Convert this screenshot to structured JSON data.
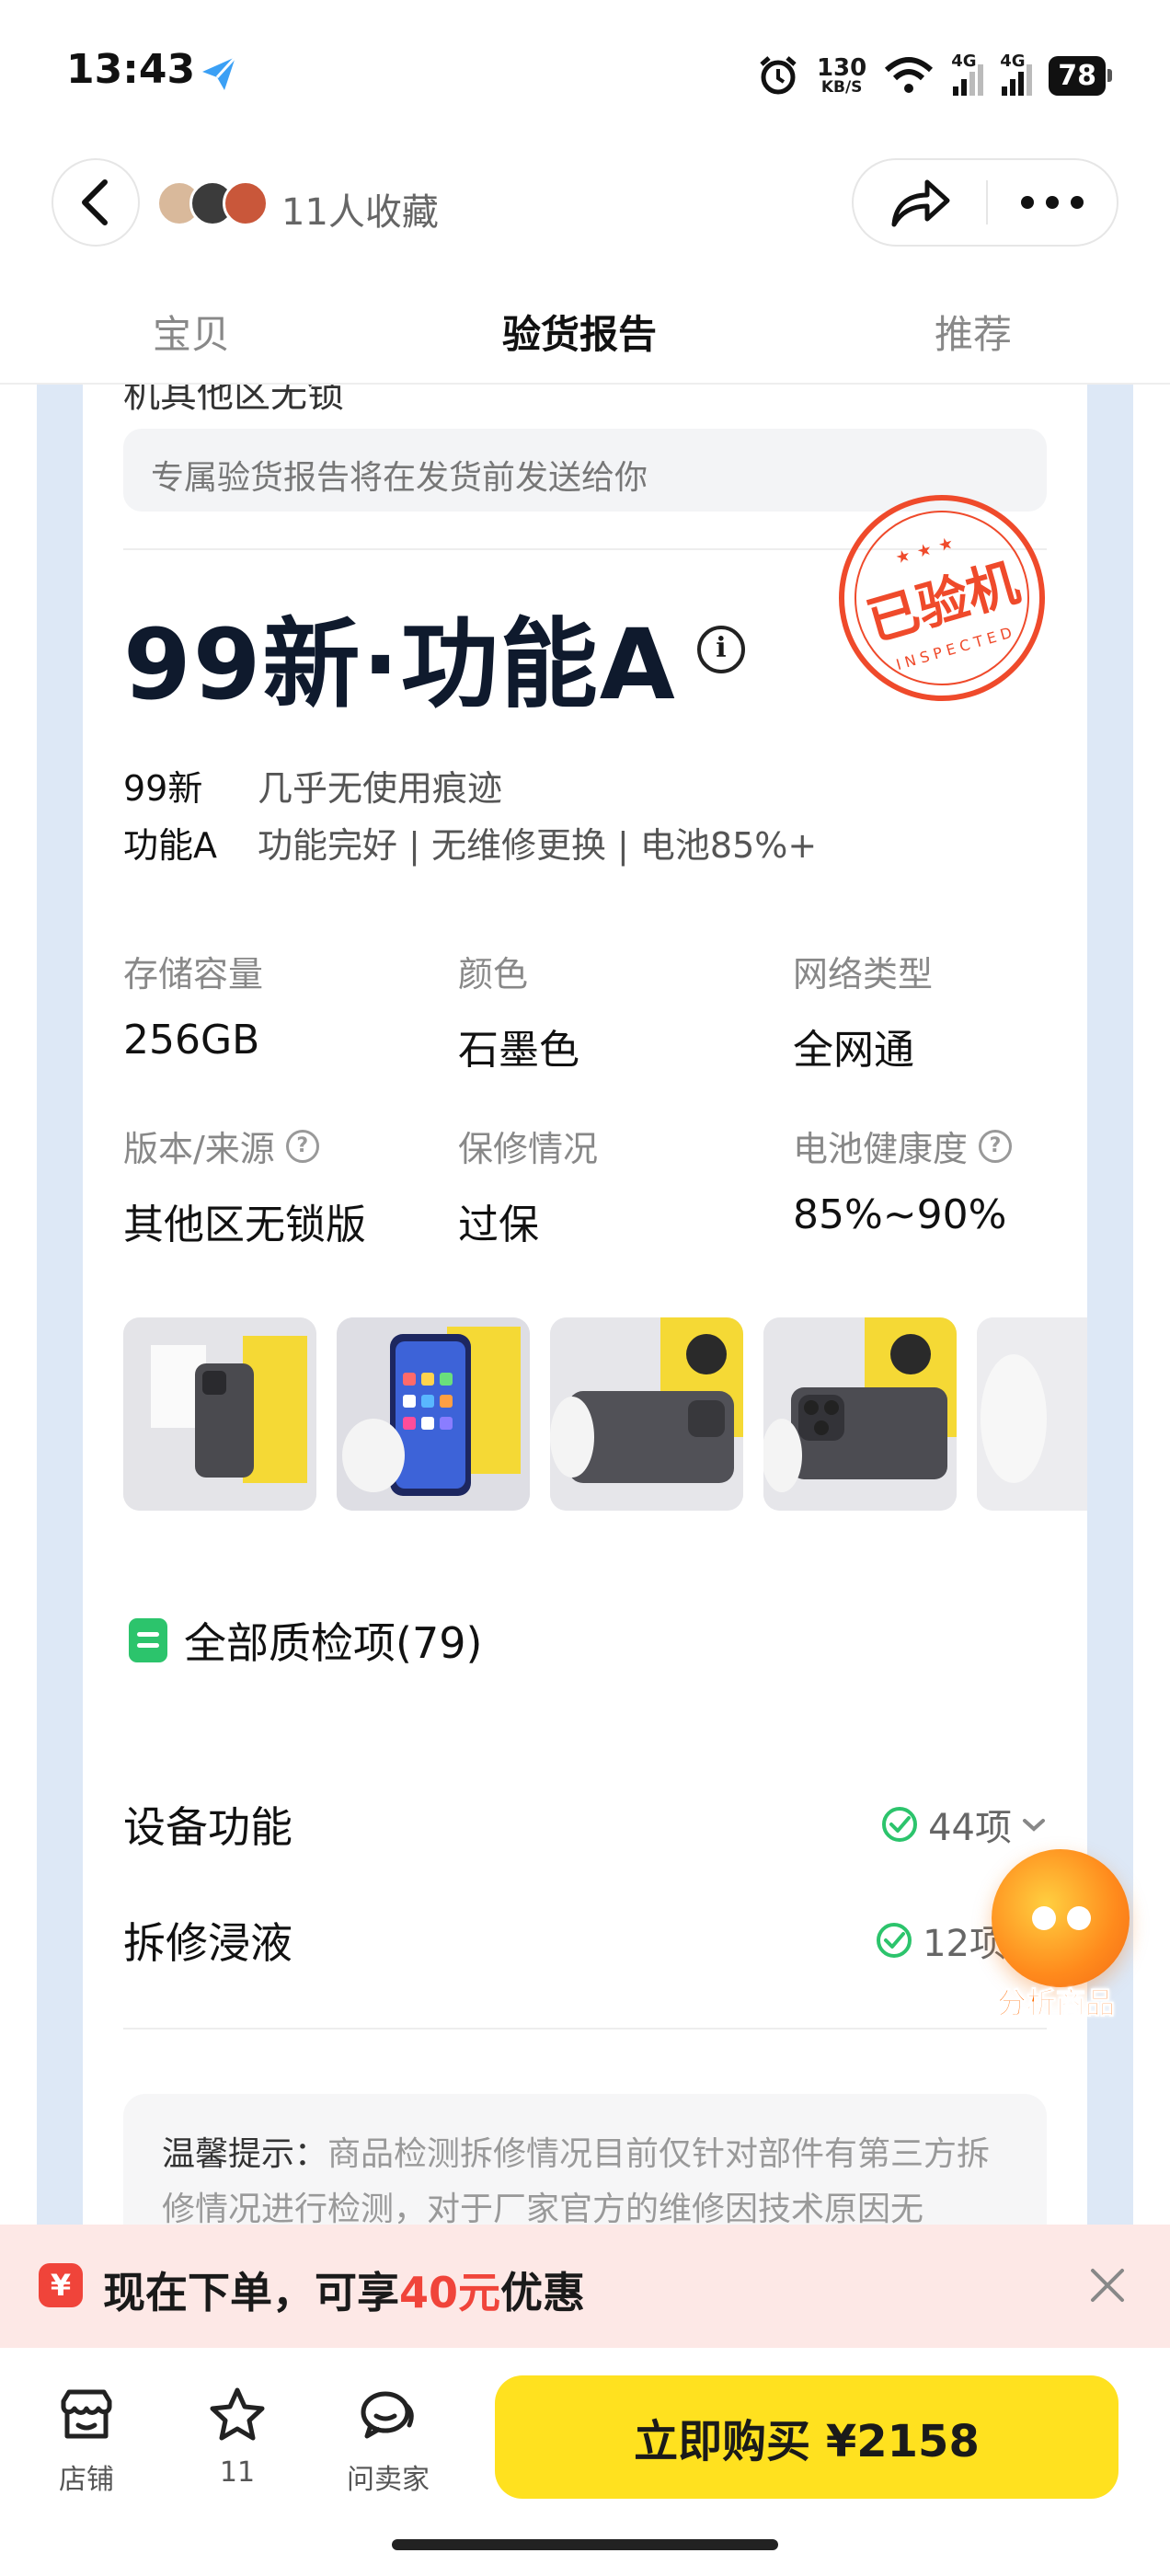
{
  "status_bar": {
    "time": "13:43",
    "speed_value": "130",
    "speed_unit": "KB/S",
    "net1": "4G",
    "net2": "4G",
    "battery": "78"
  },
  "header": {
    "fav_text": "11人收藏"
  },
  "tabs": [
    {
      "label": "宝贝",
      "active": false
    },
    {
      "label": "验货报告",
      "active": true
    },
    {
      "label": "推荐",
      "active": false
    }
  ],
  "report": {
    "cut_title": "机其他区无锁",
    "notice": "专属验货报告将在发货前发送给你",
    "grade_title": "99新·功能A",
    "stamp_main": "已验机",
    "stamp_sub": "INSPECTED",
    "grades": [
      {
        "key": "99新",
        "value": "几乎无使用痕迹"
      },
      {
        "key": "功能A",
        "value": "功能完好 | 无维修更换 | 电池85%+"
      }
    ],
    "specs": [
      {
        "label": "存储容量",
        "value": "256GB",
        "help": false
      },
      {
        "label": "颜色",
        "value": "石墨色",
        "help": false
      },
      {
        "label": "网络类型",
        "value": "全网通",
        "help": false
      },
      {
        "label": "版本/来源",
        "value": "其他区无锁版",
        "help": true
      },
      {
        "label": "保修情况",
        "value": "过保",
        "help": false
      },
      {
        "label": "电池健康度",
        "value": "85%~90%",
        "help": true
      }
    ],
    "all_items": "全部质检项(79)",
    "checks": [
      {
        "name": "设备功能",
        "result": "44项"
      },
      {
        "name": "拆修浸液",
        "result": "12项"
      }
    ],
    "tip_title": "温馨提示：",
    "tip_body": "商品检测拆修情况目前仅针对部件有第三方拆修情况进行检测，对于厂家官方的维修因技术原因无"
  },
  "float_button": {
    "label": "分析商品"
  },
  "promo": {
    "badge": "¥",
    "prefix": "现在下单，可享",
    "amount": "40元",
    "suffix": "优惠"
  },
  "bottom_bar": {
    "shop": "店铺",
    "fav_count": "11",
    "ask": "问卖家",
    "buy": "立即购买 ¥2158"
  },
  "colors": {
    "accent_yellow": "#ffe11f",
    "promo_red": "#f0443a",
    "check_green": "#2cc46c",
    "stamp_red": "#ef4a2b"
  }
}
